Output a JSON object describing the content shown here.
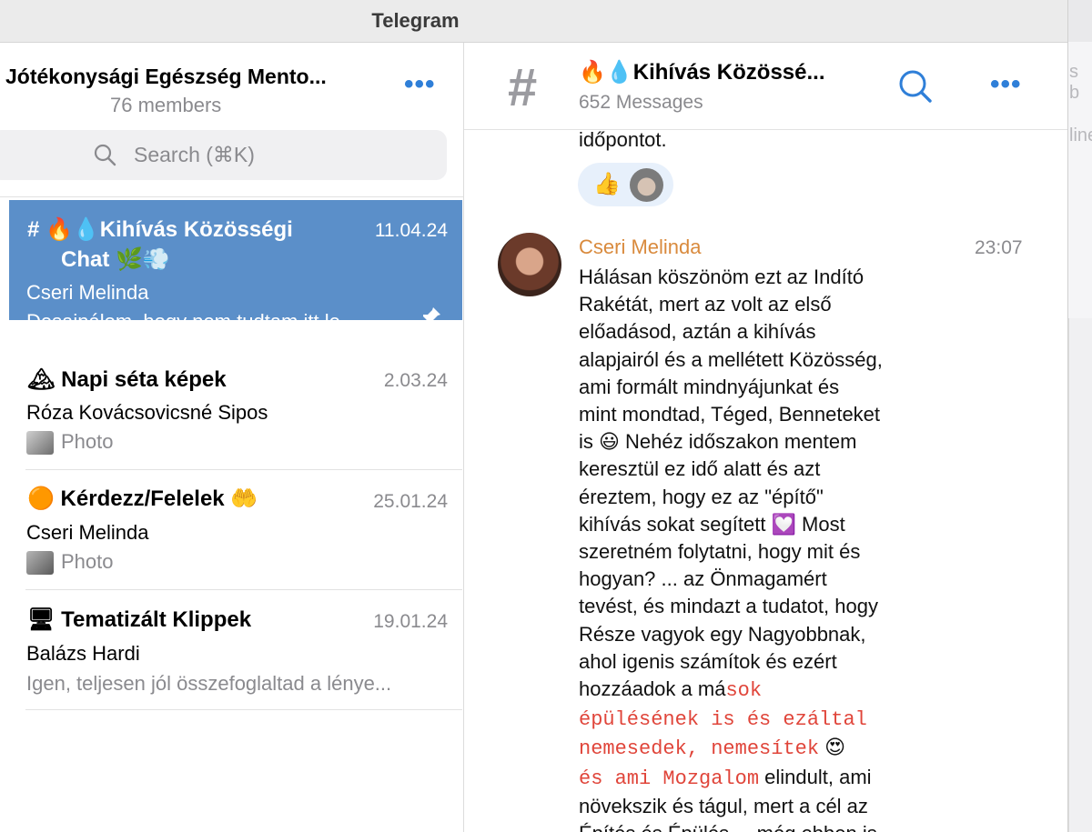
{
  "window": {
    "title": "Telegram"
  },
  "group": {
    "title": "Jótékonysági Egészség Mento...",
    "members": "76 members"
  },
  "search": {
    "placeholder": "Search (⌘K)"
  },
  "chats": [
    {
      "name": "# 🔥💧Kihívás Közösségi",
      "name_line2": "Chat 🌿💨",
      "date": "11.04.24",
      "sender": "Cseri Melinda",
      "preview": "Desajnálom, hogy nem tudtam itt le...",
      "pinned": true
    },
    {
      "name": "🏔 Napi séta képek",
      "date": "2.03.24",
      "sender": "Róza Kovácsovicsné Sipos",
      "preview": "Photo"
    },
    {
      "name": "🟠 Kérdezz/Felelek 🤲",
      "date": "25.01.24",
      "sender": "Cseri Melinda",
      "preview": "Photo"
    },
    {
      "name": "🖥 Tematizált Klippek",
      "date": "19.01.24",
      "sender": "Balázs Hardi",
      "preview": "Igen, teljesen jól összefoglaltad a lénye..."
    }
  ],
  "channel": {
    "title": "🔥💧Kihívás Közössé...",
    "subtitle": "652 Messages"
  },
  "messages": {
    "prev_tail": "időpontot.",
    "reaction": "👍",
    "author": "Cseri Melinda",
    "time": "23:07",
    "lines": [
      "Hálásan köszönöm ezt az Indító",
      "Rakétát, mert az volt az első",
      "előadásod, aztán a kihívás",
      "alapjairól és a mellétett Közösség,",
      "ami formált mindnyájunkat és",
      "mint mondtad, Téged, Benneteket",
      "is 😃 Nehéz időszakon mentem",
      "keresztül ez idő alatt és azt",
      "éreztem, hogy ez az \"építő\"",
      "kihívás sokat segített 💟 Most",
      "szeretném folytatni, hogy mit és",
      "hogyan? ... az Önmagamért",
      "tevést, és mindazt a tudatot, hogy",
      "Része vagyok egy Nagyobbnak,",
      "ahol igenis számítok és ezért"
    ],
    "line16_plain": "hozzáadok a má",
    "line16_code": "sok",
    "line17_code": "épülésének is és ezáltal",
    "line18_code": "nemesedek, nemesítek",
    "line18_emoji": "😍",
    "line19_code": "és ami Mozgalom",
    "line19_plain": " elindult, ami",
    "line20": "növekszik és tágul, mert a cél az",
    "line21": "Építés és Épülés ... még ebben is"
  },
  "edge": {
    "t1": "s b",
    "t2": "line"
  }
}
